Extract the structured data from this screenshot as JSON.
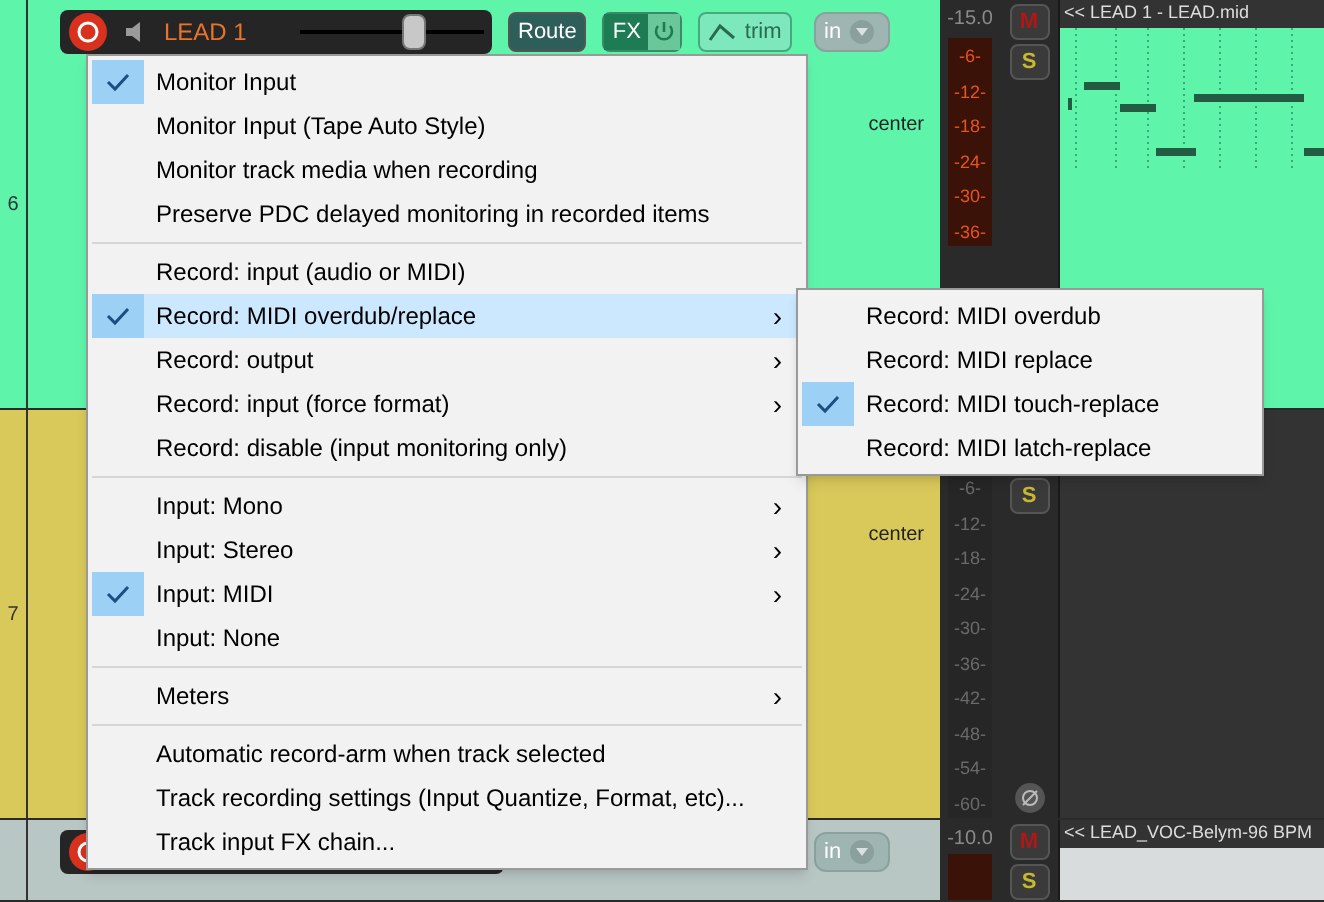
{
  "tracks": [
    {
      "number": "6",
      "color": "#5ef5ab",
      "header": {
        "armed": true,
        "name": "LEAD 1",
        "volume": {
          "level": 0.62
        },
        "buttons": [
          "Route",
          "FX",
          "trim"
        ],
        "input": "in"
      },
      "pan": "center",
      "volume_reading": "-15.0",
      "meter_active": true,
      "meter_labels": [
        "-6-",
        "-12-",
        "-18-",
        "-24-",
        "-30-",
        "-36-"
      ],
      "mute": "M",
      "solo": "S",
      "item": "<< LEAD 1 - LEAD.mid"
    },
    {
      "number": "7",
      "color": "#d9c95b",
      "pan": "center",
      "meter_active": false,
      "meter_labels": [
        "-6-",
        "-12-",
        "-18-",
        "-24-",
        "-30-",
        "-36-",
        "-42-",
        "-48-",
        "-54-",
        "-60-"
      ],
      "solo": "S"
    },
    {
      "color": "#b8c6c4",
      "header": {
        "armed": true,
        "input": "in"
      },
      "volume_reading": "-10.0",
      "meter_active": true,
      "mute": "M",
      "solo": "S",
      "item": "<< LEAD_VOC-Belym-96 BPM"
    }
  ],
  "menu": {
    "groups": [
      [
        {
          "label": "Monitor Input",
          "checked": true,
          "submenu": false,
          "selected": false
        },
        {
          "label": "Monitor Input (Tape Auto Style)",
          "checked": false,
          "submenu": false,
          "selected": false
        },
        {
          "label": "Monitor track media when recording",
          "checked": false,
          "submenu": false,
          "selected": false
        },
        {
          "label": "Preserve PDC delayed monitoring in recorded items",
          "checked": false,
          "submenu": false,
          "selected": false
        }
      ],
      [
        {
          "label": "Record: input (audio or MIDI)",
          "checked": false,
          "submenu": false,
          "selected": false
        },
        {
          "label": "Record: MIDI overdub/replace",
          "checked": true,
          "submenu": true,
          "selected": true
        },
        {
          "label": "Record: output",
          "checked": false,
          "submenu": true,
          "selected": false
        },
        {
          "label": "Record: input (force format)",
          "checked": false,
          "submenu": true,
          "selected": false
        },
        {
          "label": "Record: disable (input monitoring only)",
          "checked": false,
          "submenu": false,
          "selected": false
        }
      ],
      [
        {
          "label": "Input: Mono",
          "checked": false,
          "submenu": true,
          "selected": false
        },
        {
          "label": "Input: Stereo",
          "checked": false,
          "submenu": true,
          "selected": false
        },
        {
          "label": "Input: MIDI",
          "checked": true,
          "submenu": true,
          "selected": false
        },
        {
          "label": "Input: None",
          "checked": false,
          "submenu": false,
          "selected": false
        }
      ],
      [
        {
          "label": "Meters",
          "checked": false,
          "submenu": true,
          "selected": false
        }
      ],
      [
        {
          "label": "Automatic record-arm when track selected",
          "checked": false,
          "submenu": false,
          "selected": false
        },
        {
          "label": "Track recording settings (Input Quantize, Format, etc)...",
          "checked": false,
          "submenu": false,
          "selected": false
        },
        {
          "label": "Track input FX chain...",
          "checked": false,
          "submenu": false,
          "selected": false
        }
      ]
    ],
    "submenu_arrow": "›"
  },
  "submenu": {
    "items": [
      {
        "label": "Record: MIDI overdub",
        "checked": false
      },
      {
        "label": "Record: MIDI replace",
        "checked": false
      },
      {
        "label": "Record: MIDI touch-replace",
        "checked": true
      },
      {
        "label": "Record: MIDI latch-replace",
        "checked": false
      }
    ]
  }
}
